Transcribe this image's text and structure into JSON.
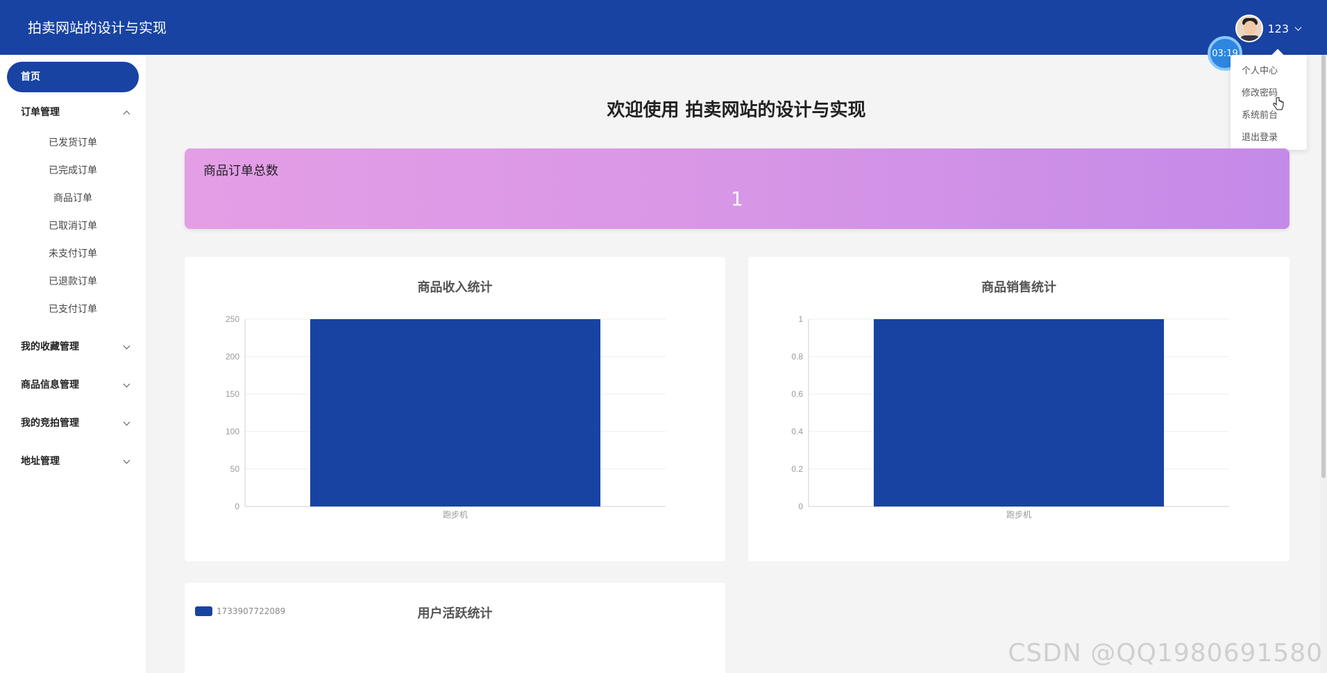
{
  "header": {
    "title": "拍卖网站的设计与实现",
    "username": "123",
    "timer": "03:19"
  },
  "user_menu": {
    "items": [
      "个人中心",
      "修改密码",
      "系统前台",
      "退出登录"
    ]
  },
  "sidebar": {
    "home": "首页",
    "order_group": "订单管理",
    "order_items": [
      "已发货订单",
      "已完成订单",
      "商品订单",
      "已取消订单",
      "未支付订单",
      "已退款订单",
      "已支付订单"
    ],
    "groups": [
      "我的收藏管理",
      "商品信息管理",
      "我的竞拍管理",
      "地址管理"
    ]
  },
  "main": {
    "welcome": "欢迎使用 拍卖网站的设计与实现",
    "stat_label": "商品订单总数",
    "stat_value": "1"
  },
  "charts": {
    "active_legend": "1733907722089",
    "active_title": "用户活跃统计"
  },
  "chart_data": [
    {
      "type": "bar",
      "title": "商品收入统计",
      "categories": [
        "跑步机"
      ],
      "values": [
        250
      ],
      "ylim": [
        0,
        250
      ],
      "yticks": [
        "0",
        "50",
        "100",
        "150",
        "200",
        "250"
      ],
      "color": "#1843a3",
      "grid": true
    },
    {
      "type": "bar",
      "title": "商品销售统计",
      "categories": [
        "跑步机"
      ],
      "values": [
        1
      ],
      "ylim": [
        0,
        1
      ],
      "yticks": [
        "0",
        "0.2",
        "0.4",
        "0.6",
        "0.8",
        "1"
      ],
      "color": "#1843a3",
      "grid": true
    }
  ],
  "watermark": "CSDN @QQ1980691580",
  "theme": {
    "primary": "#1843a3"
  }
}
